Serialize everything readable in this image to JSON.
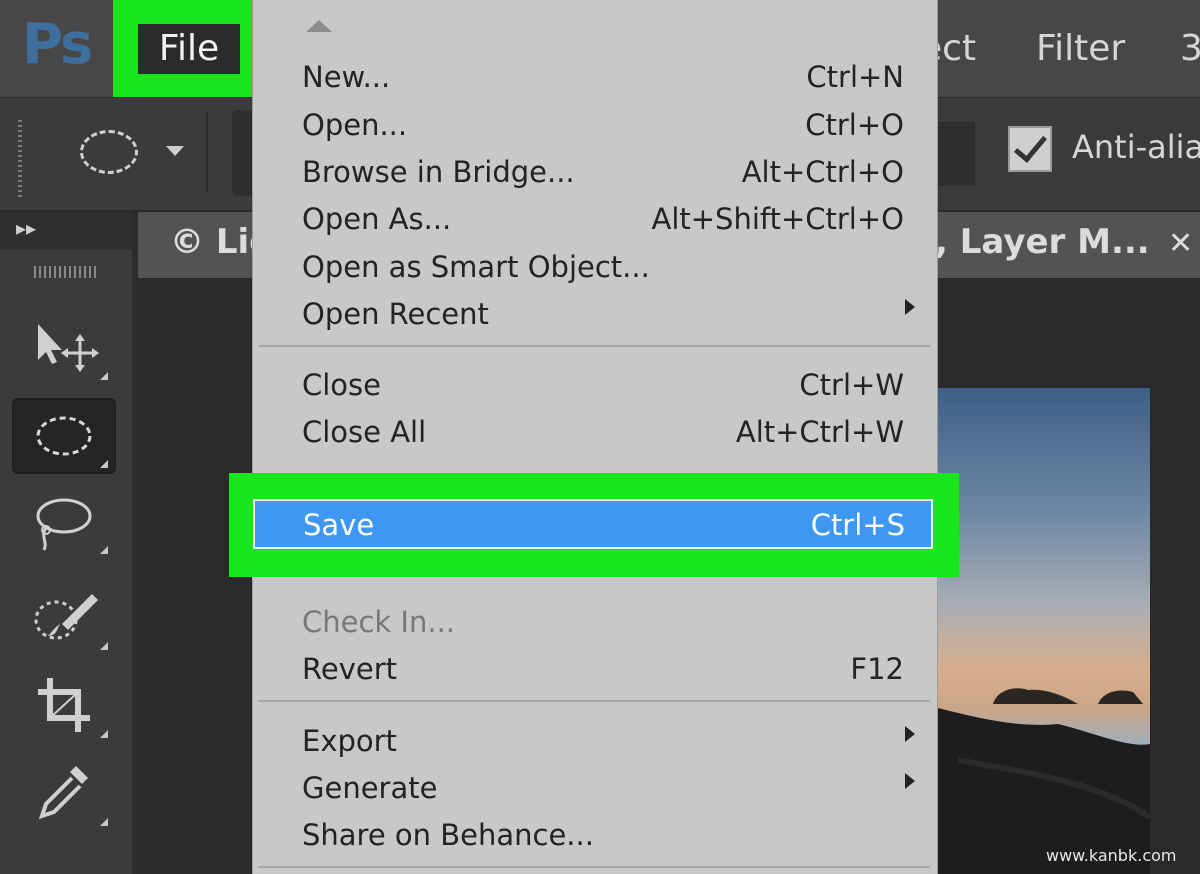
{
  "app": {
    "logo": "Ps"
  },
  "menubar": {
    "file": "File",
    "partial_item": "ect",
    "filter": "Filter",
    "partial_next": "3"
  },
  "options": {
    "anti_alias": "Anti-alias",
    "anti_alias_checked": true
  },
  "document": {
    "tab_left": "© Lig",
    "tab_right": ", Layer M...",
    "close_glyph": "✕"
  },
  "file_menu": {
    "groups": [
      [
        {
          "label": "New...",
          "shortcut": "Ctrl+N"
        },
        {
          "label": "Open...",
          "shortcut": "Ctrl+O"
        },
        {
          "label": "Browse in Bridge...",
          "shortcut": "Alt+Ctrl+O"
        },
        {
          "label": "Open As...",
          "shortcut": "Alt+Shift+Ctrl+O"
        },
        {
          "label": "Open as Smart Object...",
          "shortcut": ""
        },
        {
          "label": "Open Recent",
          "shortcut": "",
          "submenu": true
        }
      ],
      [
        {
          "label": "Close",
          "shortcut": "Ctrl+W"
        },
        {
          "label": "Close All",
          "shortcut": "Alt+Ctrl+W"
        },
        {
          "label": "Save",
          "shortcut": "Ctrl+S",
          "highlighted": true
        },
        {
          "label": "Check In...",
          "shortcut": "",
          "disabled": true
        },
        {
          "label": "Revert",
          "shortcut": "F12"
        }
      ],
      [
        {
          "label": "Export",
          "shortcut": "",
          "submenu": true
        },
        {
          "label": "Generate",
          "shortcut": "",
          "submenu": true
        },
        {
          "label": "Share on Behance...",
          "shortcut": ""
        }
      ]
    ]
  },
  "tools": [
    {
      "icon": "move-tool-icon"
    },
    {
      "icon": "elliptical-marquee-icon",
      "active": true
    },
    {
      "icon": "lasso-icon"
    },
    {
      "icon": "quick-selection-icon"
    },
    {
      "icon": "crop-icon"
    },
    {
      "icon": "eyedropper-icon"
    }
  ],
  "colors": {
    "highlight_green": "#17e51d",
    "selection_blue": "#3d97f3",
    "menu_bg": "#c8c8c8"
  },
  "watermark": "www.kanbk.com"
}
